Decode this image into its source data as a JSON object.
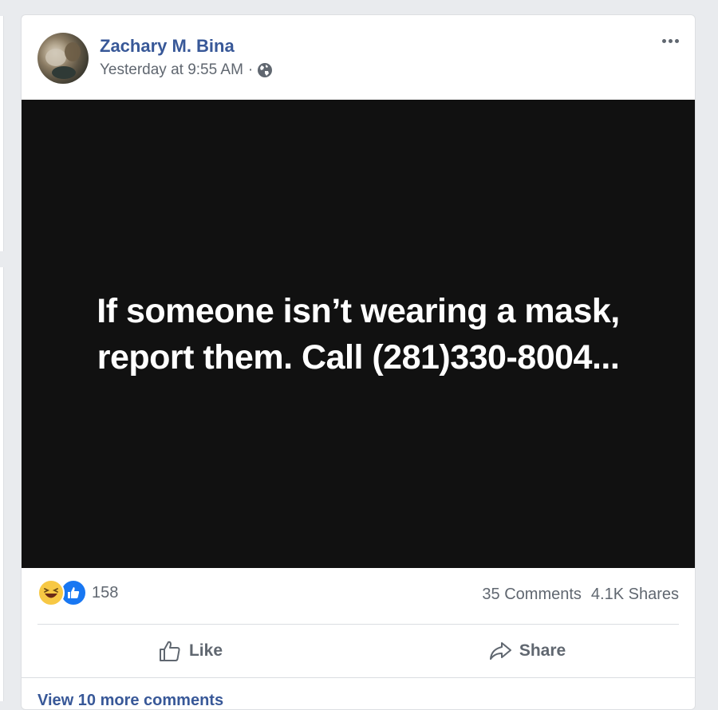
{
  "post": {
    "author": "Zachary M. Bina",
    "timestamp": "Yesterday at 9:55 AM",
    "separator": "·",
    "privacy_icon": "globe-icon",
    "image_text": "If someone isn’t wearing a mask, report them. Call (281)330-8004...",
    "reactions": {
      "types": [
        "haha",
        "like"
      ],
      "count": "158"
    },
    "comments_label": "35 Comments",
    "shares_label": "4.1K Shares",
    "actions": {
      "like_label": "Like",
      "share_label": "Share"
    },
    "view_more_label": "View 10 more comments"
  },
  "colors": {
    "link": "#385898",
    "meta": "#606770",
    "like_blue": "#1877f2",
    "haha_yellow": "#f7c844"
  }
}
